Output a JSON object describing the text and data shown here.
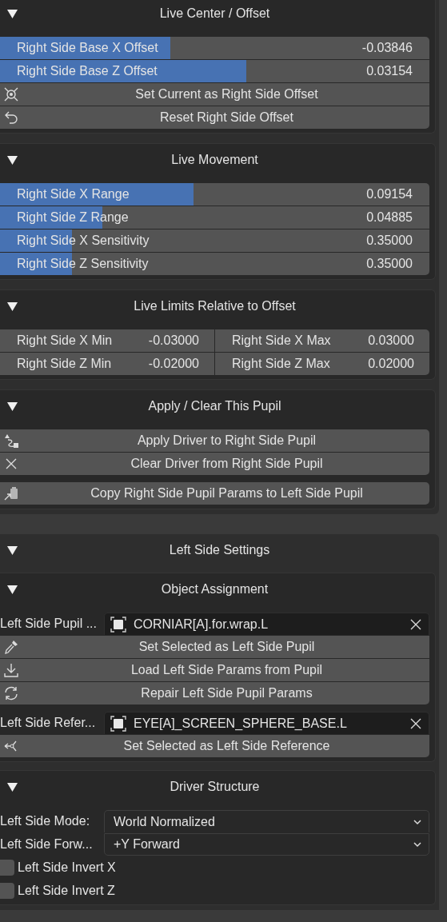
{
  "right_side_panels": [
    {
      "title": "Live Center / Offset",
      "expanded": true,
      "groups": [
        [
          {
            "kind": "slider",
            "label": "Right Side Base X Offset",
            "value": "-0.03846",
            "level": 0.396
          },
          {
            "kind": "slider",
            "label": "Right Side Base Z Offset",
            "value": "0.03154",
            "level": 0.573
          },
          {
            "kind": "button",
            "label": "Set Current as Right Side Offset"
          },
          {
            "kind": "button",
            "label": "Reset Right Side Offset"
          }
        ]
      ]
    },
    {
      "title": "Live Movement",
      "expanded": true,
      "groups": [
        [
          {
            "kind": "slider",
            "label": "Right Side X Range",
            "value": "0.09154",
            "level": 0.451
          },
          {
            "kind": "slider",
            "label": "Right Side Z Range",
            "value": "0.04885",
            "level": 0.238
          },
          {
            "kind": "slider",
            "label": "Right Side X Sensitivity",
            "value": "0.35000",
            "level": 0.167
          },
          {
            "kind": "slider",
            "label": "Right Side Z Sensitivity",
            "value": "0.35000",
            "level": 0.167
          }
        ]
      ]
    },
    {
      "title": "Live Limits Relative to Offset",
      "expanded": true,
      "groups": [
        [
          {
            "kind": "number_pair",
            "fields": [
              {
                "label": "Right Side X Min",
                "value": "-0.03000"
              },
              {
                "label": "Right Side X Max",
                "value": "0.03000"
              }
            ]
          },
          {
            "kind": "number_pair",
            "fields": [
              {
                "label": "Right Side Z Min",
                "value": "-0.02000"
              },
              {
                "label": "Right Side Z Max",
                "value": "0.02000"
              }
            ]
          }
        ]
      ]
    },
    {
      "title": "Apply / Clear This Pupil",
      "expanded": true,
      "groups": [
        [
          {
            "kind": "button",
            "label": "Apply Driver to Right Side Pupil"
          },
          {
            "kind": "button",
            "label": "Clear Driver from Right Side Pupil"
          }
        ],
        [
          {
            "kind": "button",
            "label": "Copy Right Side Pupil Params to Left Side Pupil"
          }
        ]
      ]
    }
  ],
  "left_side_settings": {
    "title": "Left Side Settings",
    "expanded": true,
    "panels": [
      {
        "title": "Object Assignment",
        "expanded": true,
        "groups": [
          [
            {
              "kind": "object_field",
              "label": "Left Side Pupil ...",
              "value": "CORNIAR[A].for.wrap.L"
            },
            {
              "kind": "button",
              "label": "Set Selected as Left Side Pupil"
            },
            {
              "kind": "button",
              "label": "Load Left Side Params from Pupil"
            },
            {
              "kind": "button",
              "label": "Repair Left Side Pupil Params"
            }
          ],
          [
            {
              "kind": "object_field",
              "label": "Left Side Refer...",
              "value": "EYE[A]_SCREEN_SPHERE_BASE.L"
            },
            {
              "kind": "button",
              "label": "Set Selected as Left Side Reference"
            }
          ]
        ]
      },
      {
        "title": "Driver Structure",
        "expanded": true,
        "groups": [
          [
            {
              "kind": "dropdown",
              "label": "Left Side Mode:",
              "value": "World Normalized"
            },
            {
              "kind": "dropdown",
              "label": "Left Side Forw...",
              "value": "+Y Forward"
            }
          ],
          [
            {
              "kind": "checkbox",
              "label": "Left Side Invert X",
              "checked": false
            },
            {
              "kind": "checkbox",
              "label": "Left Side Invert Z",
              "checked": false
            }
          ]
        ]
      }
    ]
  }
}
